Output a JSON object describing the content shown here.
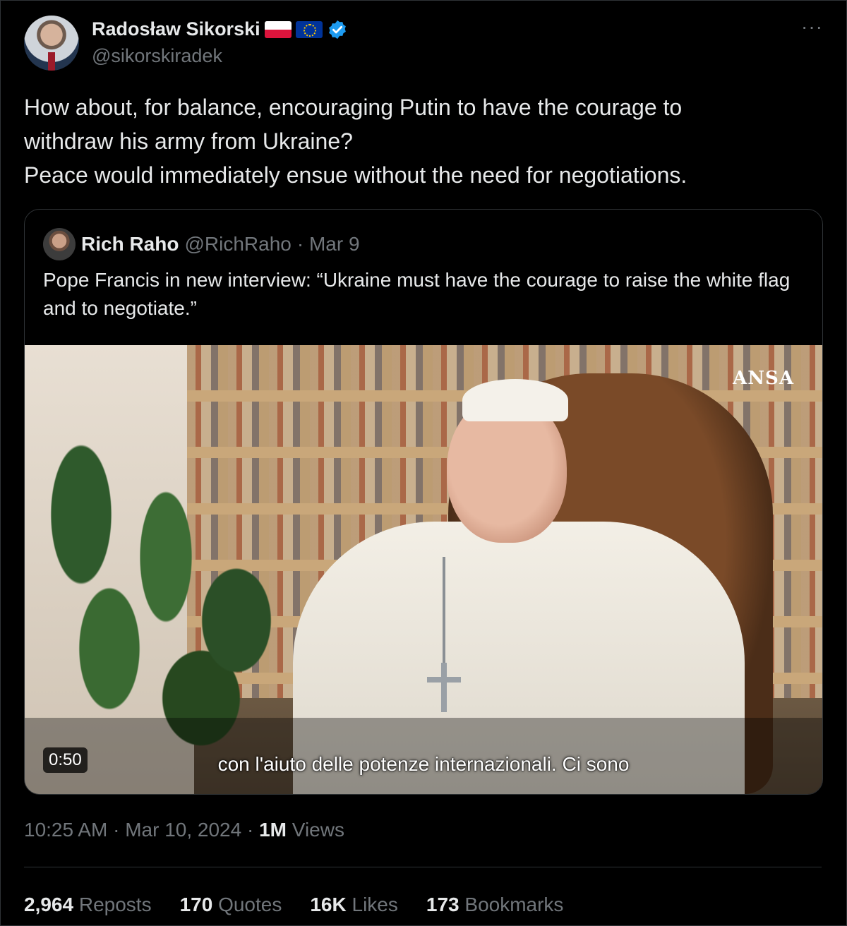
{
  "author": {
    "name": "Radosław Sikorski",
    "handle": "@sikorskiradek",
    "flags": [
      "poland-flag",
      "eu-flag"
    ],
    "verified": true
  },
  "menu": {
    "more_label": "···"
  },
  "tweet": {
    "text": "How about, for balance, encouraging Putin to have the courage to\nwithdraw his army from Ukraine?\nPeace would immediately ensue without the need for negotiations."
  },
  "quote": {
    "name": "Rich Raho",
    "handle": "@RichRaho",
    "date": "· Mar 9",
    "text": "Pope Francis in new interview: “Ukraine must have the courage to raise the white flag and to negotiate.”",
    "video": {
      "watermark": "ANSA",
      "subtitle": "con l'aiuto delle potenze internazionali. Ci sono",
      "duration": "0:50"
    }
  },
  "meta": {
    "time": "10:25 AM",
    "sep1": " · ",
    "date": "Mar 10, 2024",
    "sep2": " · ",
    "views_count": "1M",
    "views_label": " Views"
  },
  "stats": {
    "reposts": {
      "count": "2,964",
      "label": " Reposts"
    },
    "quotes": {
      "count": "170",
      "label": " Quotes"
    },
    "likes": {
      "count": "16K",
      "label": " Likes"
    },
    "bookmarks": {
      "count": "173",
      "label": " Bookmarks"
    }
  },
  "colors": {
    "background": "#000000",
    "text_primary": "#e7e9ea",
    "text_secondary": "#71767b",
    "border": "#2f3336",
    "verified_blue": "#1d9bf0"
  }
}
